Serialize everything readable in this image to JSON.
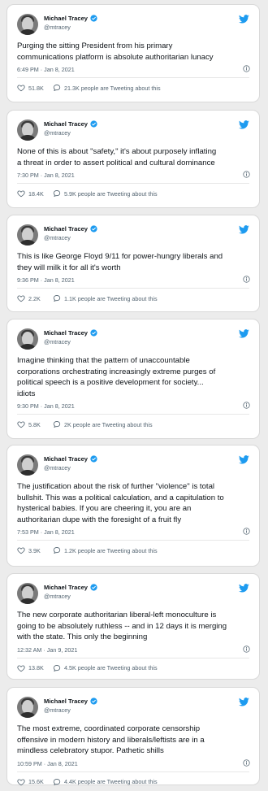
{
  "author": {
    "name": "Michael Tracey",
    "handle": "@mtracey"
  },
  "colors": {
    "twitter_blue": "#1d9bf0",
    "verified_blue": "#1d9bf0",
    "muted_text": "#536471"
  },
  "icons": {
    "logo": "twitter-bird-icon",
    "verified": "verified-badge-icon",
    "like": "heart-icon",
    "reply": "speech-bubble-icon",
    "info": "info-icon"
  },
  "tweets": [
    {
      "text_lines": [
        "Purging the sitting President from his primary",
        "communications platform is absolute authoritarian lunacy"
      ],
      "timestamp": "6:49 PM · Jan 8, 2021",
      "likes": "51.8K",
      "talk": "21.3K people are Tweeting about this"
    },
    {
      "text_lines": [
        "None of this is about \"safety,\" it's about purposely inflating",
        "a threat in order to assert political and cultural dominance"
      ],
      "timestamp": "7:30 PM · Jan 8, 2021",
      "likes": "18.4K",
      "talk": "5.9K people are Tweeting about this"
    },
    {
      "text_lines": [
        "This is like George Floyd 9/11 for power-hungry liberals and",
        "they will milk it for all it's worth"
      ],
      "timestamp": "9:36 PM · Jan 8, 2021",
      "likes": "2.2K",
      "talk": "1.1K people are Tweeting about this"
    },
    {
      "text_lines": [
        "Imagine thinking that the pattern of unaccountable",
        "corporations orchestrating increasingly extreme purges of",
        "political speech is a positive development for society...",
        "idiots"
      ],
      "timestamp": "9:30 PM · Jan 8, 2021",
      "likes": "5.8K",
      "talk": "2K people are Tweeting about this"
    },
    {
      "text_lines": [
        "The justification about the risk of further \"violence\" is total",
        "bullshit. This was a political calculation, and a capitulation to",
        "hysterical babies. If you are cheering it, you are an",
        "authoritarian dupe with the foresight of a fruit fly"
      ],
      "timestamp": "7:53 PM · Jan 8, 2021",
      "likes": "3.9K",
      "talk": "1.2K people are Tweeting about this"
    },
    {
      "text_lines": [
        "The new corporate authoritarian liberal-left monoculture is",
        "going to be absolutely ruthless -- and in 12 days it is merging",
        "with the state. This only the beginning"
      ],
      "timestamp": "12:32 AM · Jan 9, 2021",
      "likes": "13.8K",
      "talk": "4.5K people are Tweeting about this"
    },
    {
      "text_lines": [
        "The most extreme, coordinated corporate censorship",
        "offensive in modern history and liberals/leftists are in a",
        "mindless celebratory stupor. Pathetic shills"
      ],
      "timestamp": "10:59 PM · Jan 8, 2021",
      "likes": "15.6K",
      "talk": "4.4K people are Tweeting about this"
    }
  ]
}
